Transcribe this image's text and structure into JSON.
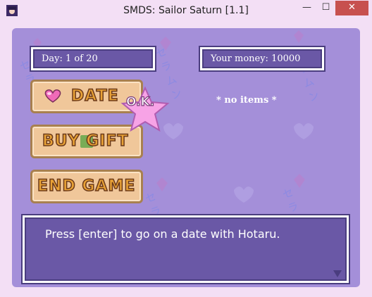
{
  "window": {
    "title": "SMDS: Sailor Saturn [1.1]",
    "minimize_label": "—",
    "maximize_label": "☐",
    "close_label": "✕"
  },
  "status": {
    "day_text": "Day: 1 of 20",
    "money_text": "Your money: 10000"
  },
  "menu": {
    "date_label": "DATE",
    "buy_gift_label": "BUY GIFT",
    "end_game_label": "END GAME"
  },
  "ok_badge": {
    "label": "O.K."
  },
  "inventory": {
    "empty_text": "* no items *"
  },
  "message": {
    "text": "Press [enter] to go on a date with Hotaru."
  },
  "background": {
    "watermark_text": "セラムン"
  },
  "colors": {
    "game_bg": "#a48fd9",
    "panel_bg": "#6a58a6",
    "button_bg": "#f0c79a",
    "button_text": "#e9a236",
    "close_button": "#c7504f",
    "star": "#f7a3e6"
  }
}
